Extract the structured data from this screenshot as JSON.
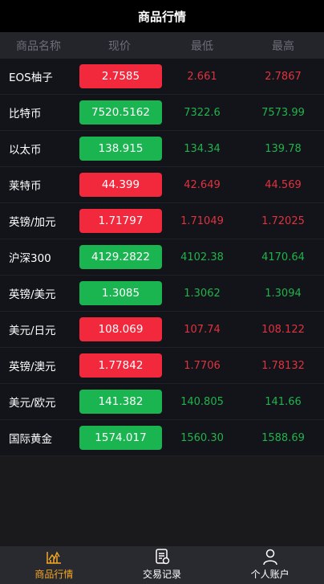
{
  "header": {
    "title": "商品行情"
  },
  "columns": {
    "name": "商品名称",
    "price": "现价",
    "low": "最低",
    "high": "最高"
  },
  "rows": [
    {
      "name": "EOS柚子",
      "price": "2.7585",
      "low": "2.661",
      "high": "2.7867",
      "trend": "down"
    },
    {
      "name": "比特币",
      "price": "7520.5162",
      "low": "7322.6",
      "high": "7573.99",
      "trend": "up"
    },
    {
      "name": "以太币",
      "price": "138.915",
      "low": "134.34",
      "high": "139.78",
      "trend": "up"
    },
    {
      "name": "莱特币",
      "price": "44.399",
      "low": "42.649",
      "high": "44.569",
      "trend": "down"
    },
    {
      "name": "英镑/加元",
      "price": "1.71797",
      "low": "1.71049",
      "high": "1.72025",
      "trend": "down"
    },
    {
      "name": "沪深300",
      "price": "4129.2822",
      "low": "4102.38",
      "high": "4170.64",
      "trend": "up"
    },
    {
      "name": "英镑/美元",
      "price": "1.3085",
      "low": "1.3062",
      "high": "1.3094",
      "trend": "up"
    },
    {
      "name": "美元/日元",
      "price": "108.069",
      "low": "107.74",
      "high": "108.122",
      "trend": "down"
    },
    {
      "name": "英镑/澳元",
      "price": "1.77842",
      "low": "1.7706",
      "high": "1.78132",
      "trend": "down"
    },
    {
      "name": "美元/欧元",
      "price": "141.382",
      "low": "140.805",
      "high": "141.66",
      "trend": "up"
    },
    {
      "name": "国际黄金",
      "price": "1574.017",
      "low": "1560.30",
      "high": "1588.69",
      "trend": "up"
    }
  ],
  "tabs": [
    {
      "label": "商品行情",
      "icon": "chart-icon",
      "active": true
    },
    {
      "label": "交易记录",
      "icon": "record-icon",
      "active": false
    },
    {
      "label": "个人账户",
      "icon": "user-icon",
      "active": false
    }
  ],
  "colors": {
    "up": "#1ab550",
    "down": "#f2283c",
    "accent": "#f5a623"
  }
}
